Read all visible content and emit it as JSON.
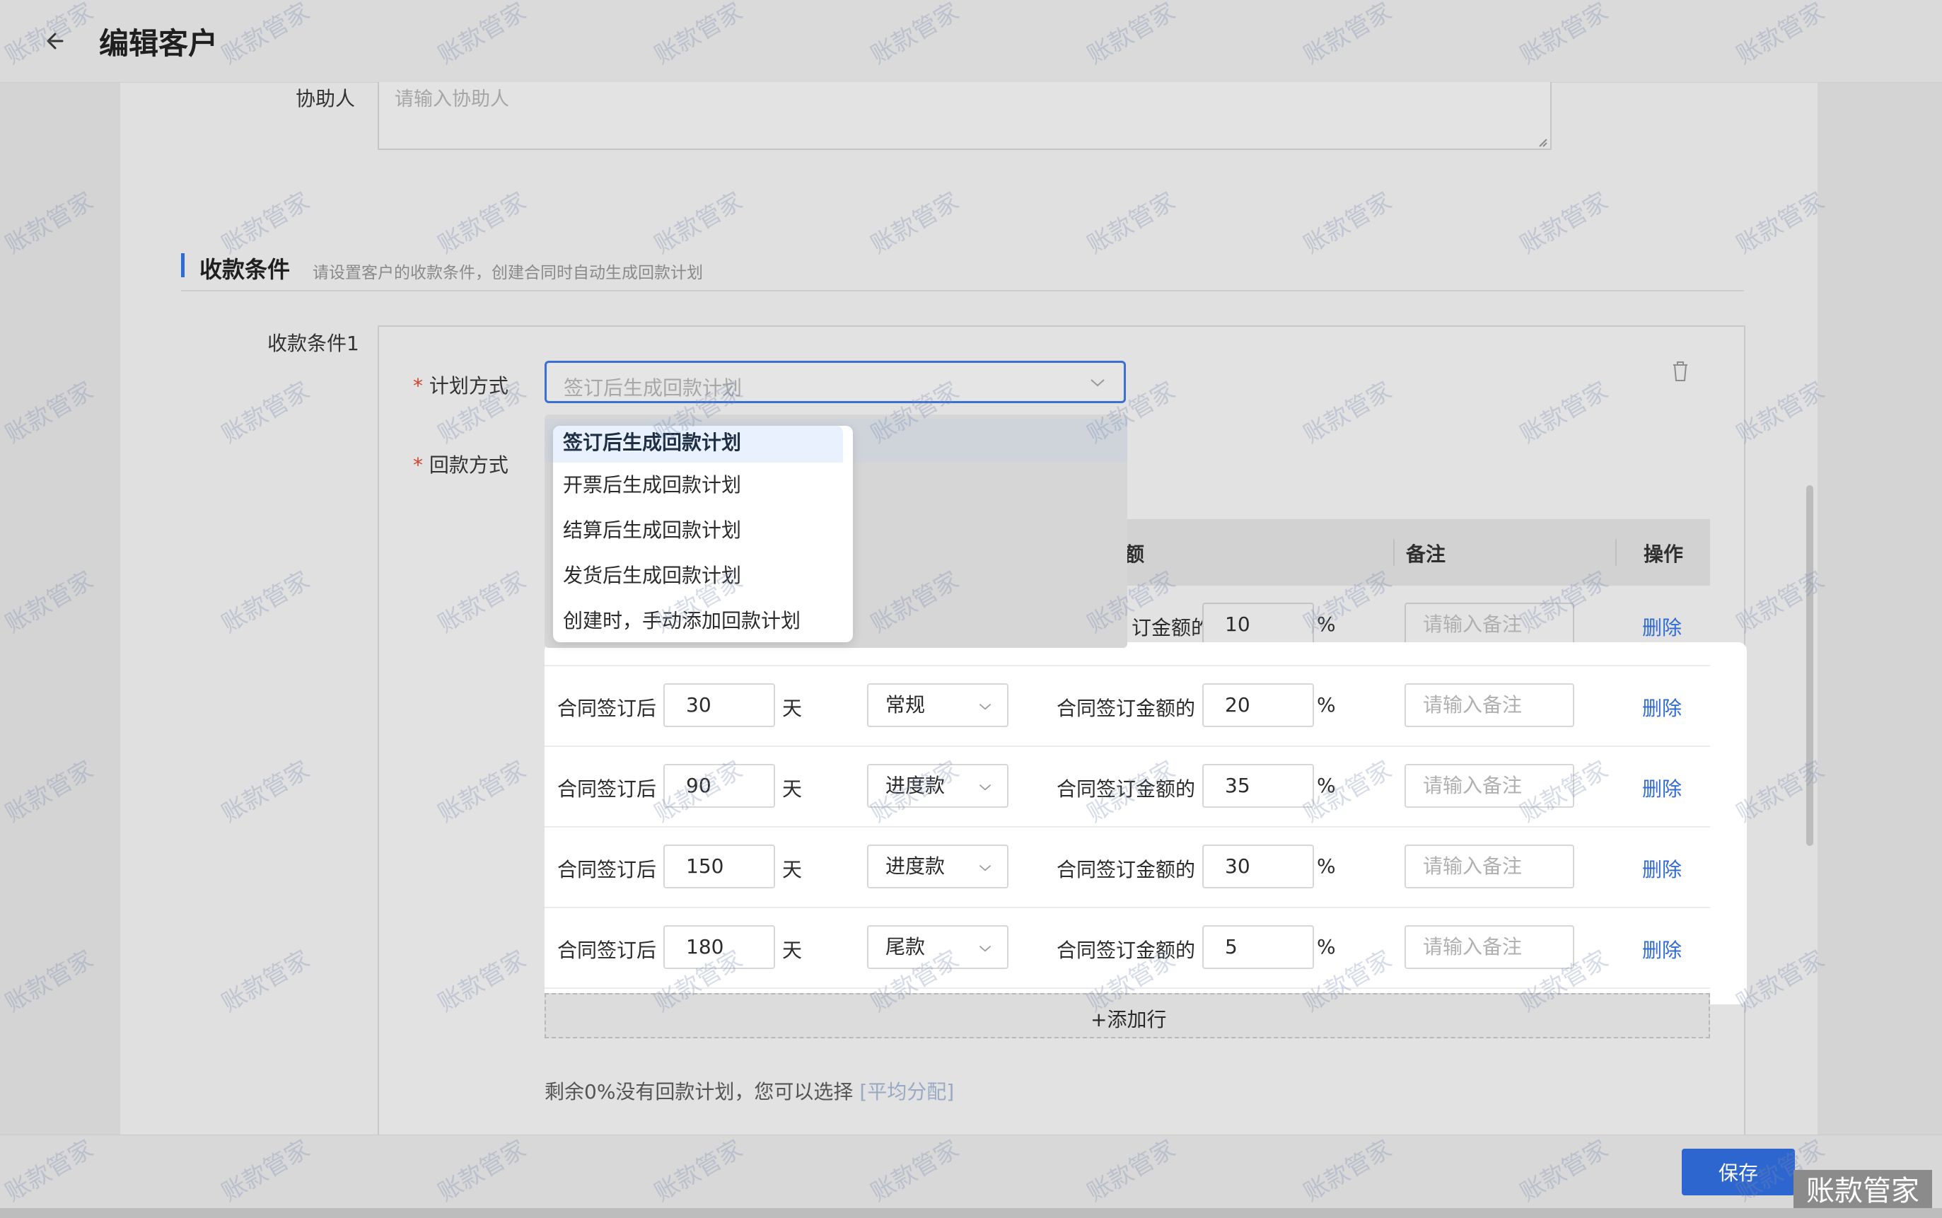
{
  "header": {
    "title": "编辑客户"
  },
  "assistant": {
    "label": "协助人",
    "placeholder": "请输入协助人"
  },
  "section": {
    "title": "收款条件",
    "subtitle": "请设置客户的收款条件，创建合同时自动生成回款计划"
  },
  "condition": {
    "label": "收款条件1",
    "plan_label": "计划方式",
    "payment_label": "回款方式",
    "required_mark": "*",
    "plan_value": "签订后生成回款计划"
  },
  "dropdown": {
    "options": [
      "签订后生成回款计划",
      "开票后生成回款计划",
      "结算后生成回款计划",
      "发货后生成回款计划",
      "创建时，手动添加回款计划"
    ],
    "selected_index": 0
  },
  "table": {
    "headers": {
      "amount_partial": "额",
      "remark": "备注",
      "action": "操作"
    },
    "first_row": {
      "amount_label_partial": "订金额的",
      "percent": "10",
      "unit": "%",
      "remark_placeholder": "请输入备注",
      "action": "删除"
    },
    "rows": [
      {
        "prefix": "合同签订后",
        "days": "30",
        "day_unit": "天",
        "type": "常规",
        "amount_label": "合同签订金额的",
        "percent": "20",
        "unit": "%",
        "remark_placeholder": "请输入备注",
        "action": "删除"
      },
      {
        "prefix": "合同签订后",
        "days": "90",
        "day_unit": "天",
        "type": "进度款",
        "amount_label": "合同签订金额的",
        "percent": "35",
        "unit": "%",
        "remark_placeholder": "请输入备注",
        "action": "删除"
      },
      {
        "prefix": "合同签订后",
        "days": "150",
        "day_unit": "天",
        "type": "进度款",
        "amount_label": "合同签订金额的",
        "percent": "30",
        "unit": "%",
        "remark_placeholder": "请输入备注",
        "action": "删除"
      },
      {
        "prefix": "合同签订后",
        "days": "180",
        "day_unit": "天",
        "type": "尾款",
        "amount_label": "合同签订金额的",
        "percent": "5",
        "unit": "%",
        "remark_placeholder": "请输入备注",
        "action": "删除"
      }
    ],
    "add_row": "+添加行"
  },
  "footnote": {
    "text": "剩余0%没有回款计划，您可以选择",
    "link": "[平均分配]"
  },
  "footer": {
    "save": "保存",
    "brand": "账款管家"
  },
  "watermark": "账款管家",
  "colors": {
    "primary": "#2e66cf",
    "required": "#d8412f",
    "link": "#2f6bd3"
  }
}
